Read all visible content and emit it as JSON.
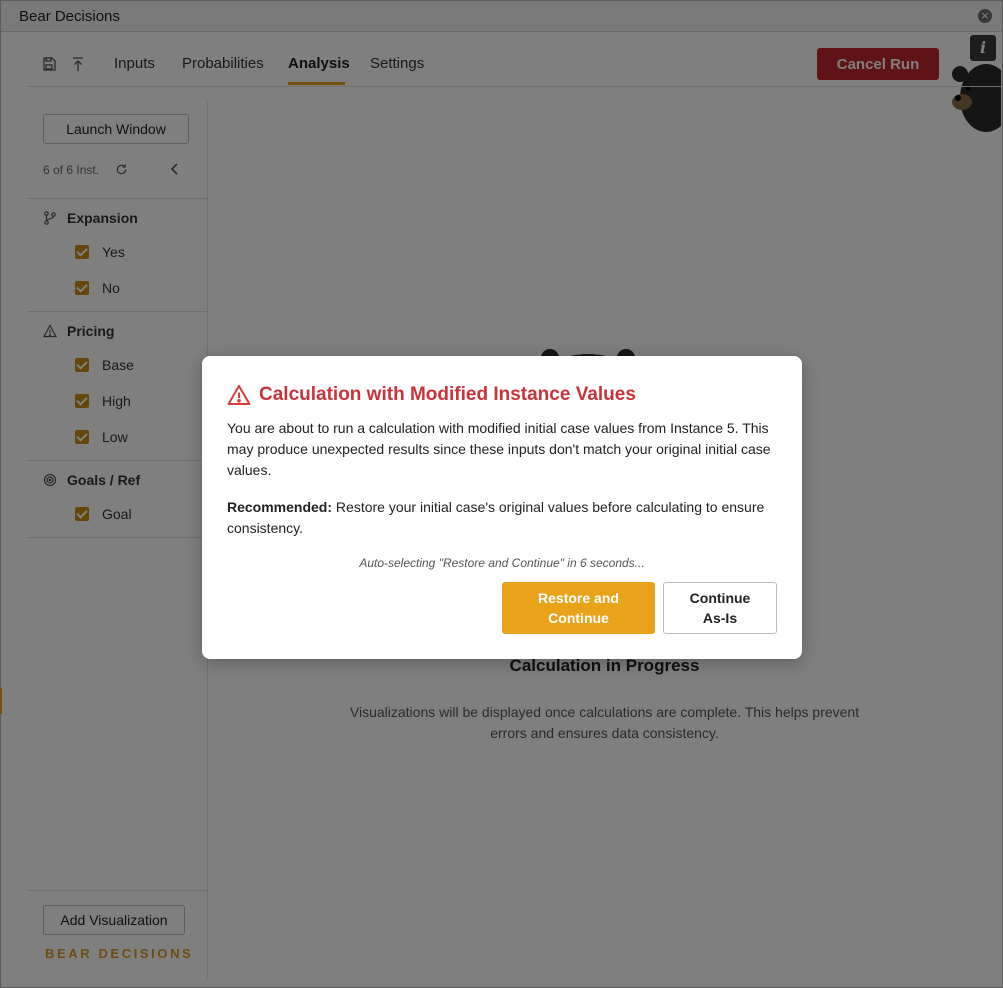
{
  "window": {
    "title": "Bear Decisions",
    "close_glyph": "×"
  },
  "toolbar": {
    "icons": [
      "save-icon",
      "upload-icon"
    ],
    "tabs": [
      {
        "label": "Inputs",
        "active": false
      },
      {
        "label": "Probabilities",
        "active": false
      },
      {
        "label": "Analysis",
        "active": true
      },
      {
        "label": "Settings",
        "active": false
      }
    ],
    "cancel_label": "Cancel Run",
    "info_glyph": "i"
  },
  "sidebar": {
    "launch_label": "Launch Window",
    "instances_text": "6 of 6 Inst.",
    "sections": [
      {
        "title": "Expansion",
        "icon": "branch-icon",
        "options": [
          {
            "label": "Yes",
            "checked": true
          },
          {
            "label": "No",
            "checked": true
          }
        ]
      },
      {
        "title": "Pricing",
        "icon": "warning-icon",
        "options": [
          {
            "label": "Base",
            "checked": true
          },
          {
            "label": "High",
            "checked": true
          },
          {
            "label": "Low",
            "checked": true
          }
        ]
      },
      {
        "title": "Goals / Ref",
        "icon": "target-icon",
        "options": [
          {
            "label": "Goal",
            "checked": true
          }
        ]
      }
    ],
    "add_visualization_label": "Add Visualization",
    "brand": "BEAR DECISIONS"
  },
  "main": {
    "calc_title": "Calculation in Progress",
    "calc_desc": "Visualizations will be displayed once calculations are complete. This helps prevent errors and ensures data consistency."
  },
  "modal": {
    "title": "Calculation with Modified Instance Values",
    "p1": "You are about to run a calculation with modified initial case values from Instance 5. This may produce unexpected results since these inputs don't match your original initial case values.",
    "p2_bold": "Recommended:",
    "p2_rest": " Restore your initial case's original values before calculating to ensure consistency.",
    "auto_text": "Auto-selecting \"Restore and Continue\" in 6 seconds...",
    "restore_label_1": "Restore and",
    "restore_label_2": "Continue",
    "continue_label_1": "Continue",
    "continue_label_2": "As-Is"
  },
  "colors": {
    "accent": "#e8a31b",
    "danger": "#c0262d",
    "checkbox": "#cc8f12"
  }
}
